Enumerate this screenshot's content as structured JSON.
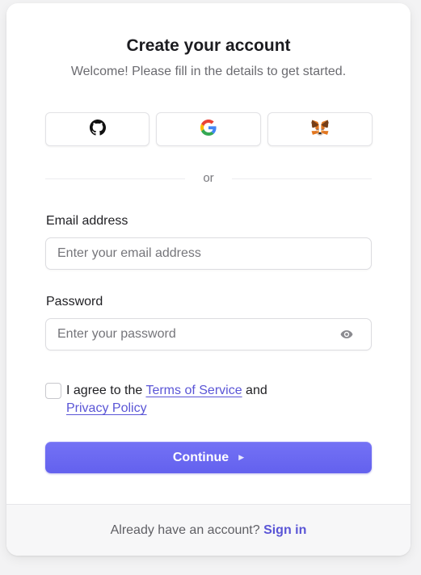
{
  "header": {
    "title": "Create your account",
    "subtitle": "Welcome! Please fill in the details to get started."
  },
  "social": [
    {
      "name": "github",
      "icon": "github-icon"
    },
    {
      "name": "google",
      "icon": "google-icon"
    },
    {
      "name": "metamask",
      "icon": "metamask-fox-icon"
    }
  ],
  "divider_text": "or",
  "email": {
    "label": "Email address",
    "placeholder": "Enter your email address",
    "value": ""
  },
  "password": {
    "label": "Password",
    "placeholder": "Enter your password",
    "value": "",
    "toggle_icon": "eye-icon"
  },
  "agreement": {
    "prefix": "I agree to the ",
    "terms_link": "Terms of Service",
    "middle": " and",
    "privacy_link": "Privacy Policy",
    "checked": false
  },
  "continue_button": {
    "label": "Continue",
    "icon": "play-arrow-icon"
  },
  "footer": {
    "text": "Already have an account? ",
    "link": "Sign in"
  },
  "colors": {
    "accent": "#6563f0",
    "link": "#5a55d6"
  }
}
